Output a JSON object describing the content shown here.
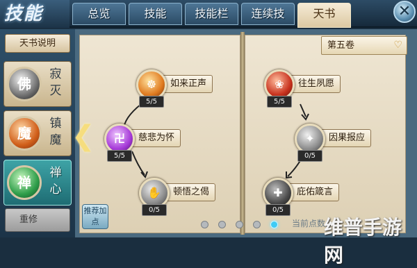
{
  "header": {
    "logo": "技能",
    "tabs": [
      {
        "label": "总览",
        "active": false
      },
      {
        "label": "技能",
        "active": false
      },
      {
        "label": "技能栏",
        "active": false
      },
      {
        "label": "连续技",
        "active": false
      },
      {
        "label": "天书",
        "active": true
      }
    ],
    "close_icon": "close-icon"
  },
  "sidebar": {
    "desc_button": "天书说明",
    "categories": [
      {
        "name": "寂灭",
        "icon": "佛",
        "active": false
      },
      {
        "name": "镇魔",
        "icon": "魔",
        "active": false
      },
      {
        "name": "禅心",
        "icon": "禅",
        "active": true
      }
    ],
    "reset_button": "重修"
  },
  "book": {
    "volume": "第五卷",
    "recommend_button": "推荐加点",
    "left_skills": [
      {
        "name": "如来正声",
        "level": "5/5",
        "color": "#e07a1f"
      },
      {
        "name": "慈悲为怀",
        "level": "5/5",
        "color": "#a63ad8"
      },
      {
        "name": "顿悟之偈",
        "level": "0/5",
        "color": "#9a9a9a"
      }
    ],
    "right_skills": [
      {
        "name": "往生夙愿",
        "level": "5/5",
        "color": "#c8321e"
      },
      {
        "name": "因果报应",
        "level": "0/5",
        "color": "#9a9a9a"
      },
      {
        "name": "庇佑箴言",
        "level": "0/5",
        "color": "#555555"
      }
    ]
  },
  "pagination": {
    "pages": 5,
    "current": 5,
    "label": "当前点数"
  },
  "watermark": "维普手游网"
}
